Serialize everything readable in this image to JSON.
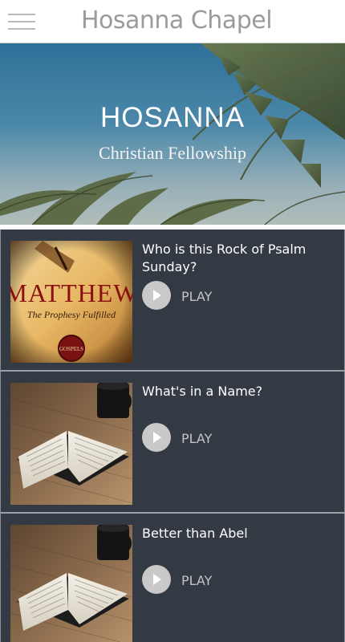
{
  "header": {
    "title": "Hosanna Chapel",
    "menu_icon": "hamburger-menu-icon"
  },
  "hero": {
    "title": "HOSANNA",
    "subtitle": "Christian Fellowship"
  },
  "sermons": [
    {
      "title": "Who is this Rock of Psalm Sunday?",
      "play_label": "PLAY",
      "thumbnail": {
        "kind": "scroll-artwork",
        "heading": "MATTHEW",
        "caption": "The Prophesy Fulfilled",
        "badge": "GOSPELS"
      }
    },
    {
      "title": "What's in a Name?",
      "play_label": "PLAY",
      "thumbnail": {
        "kind": "open-bible-photo"
      }
    },
    {
      "title": "Better than Abel",
      "play_label": "PLAY",
      "thumbnail": {
        "kind": "open-bible-photo"
      }
    }
  ],
  "colors": {
    "header_bg": "#ffffff",
    "title_gray": "#9b9b9b",
    "list_bg": "#343a43",
    "play_circle": "#c9c9c9"
  }
}
